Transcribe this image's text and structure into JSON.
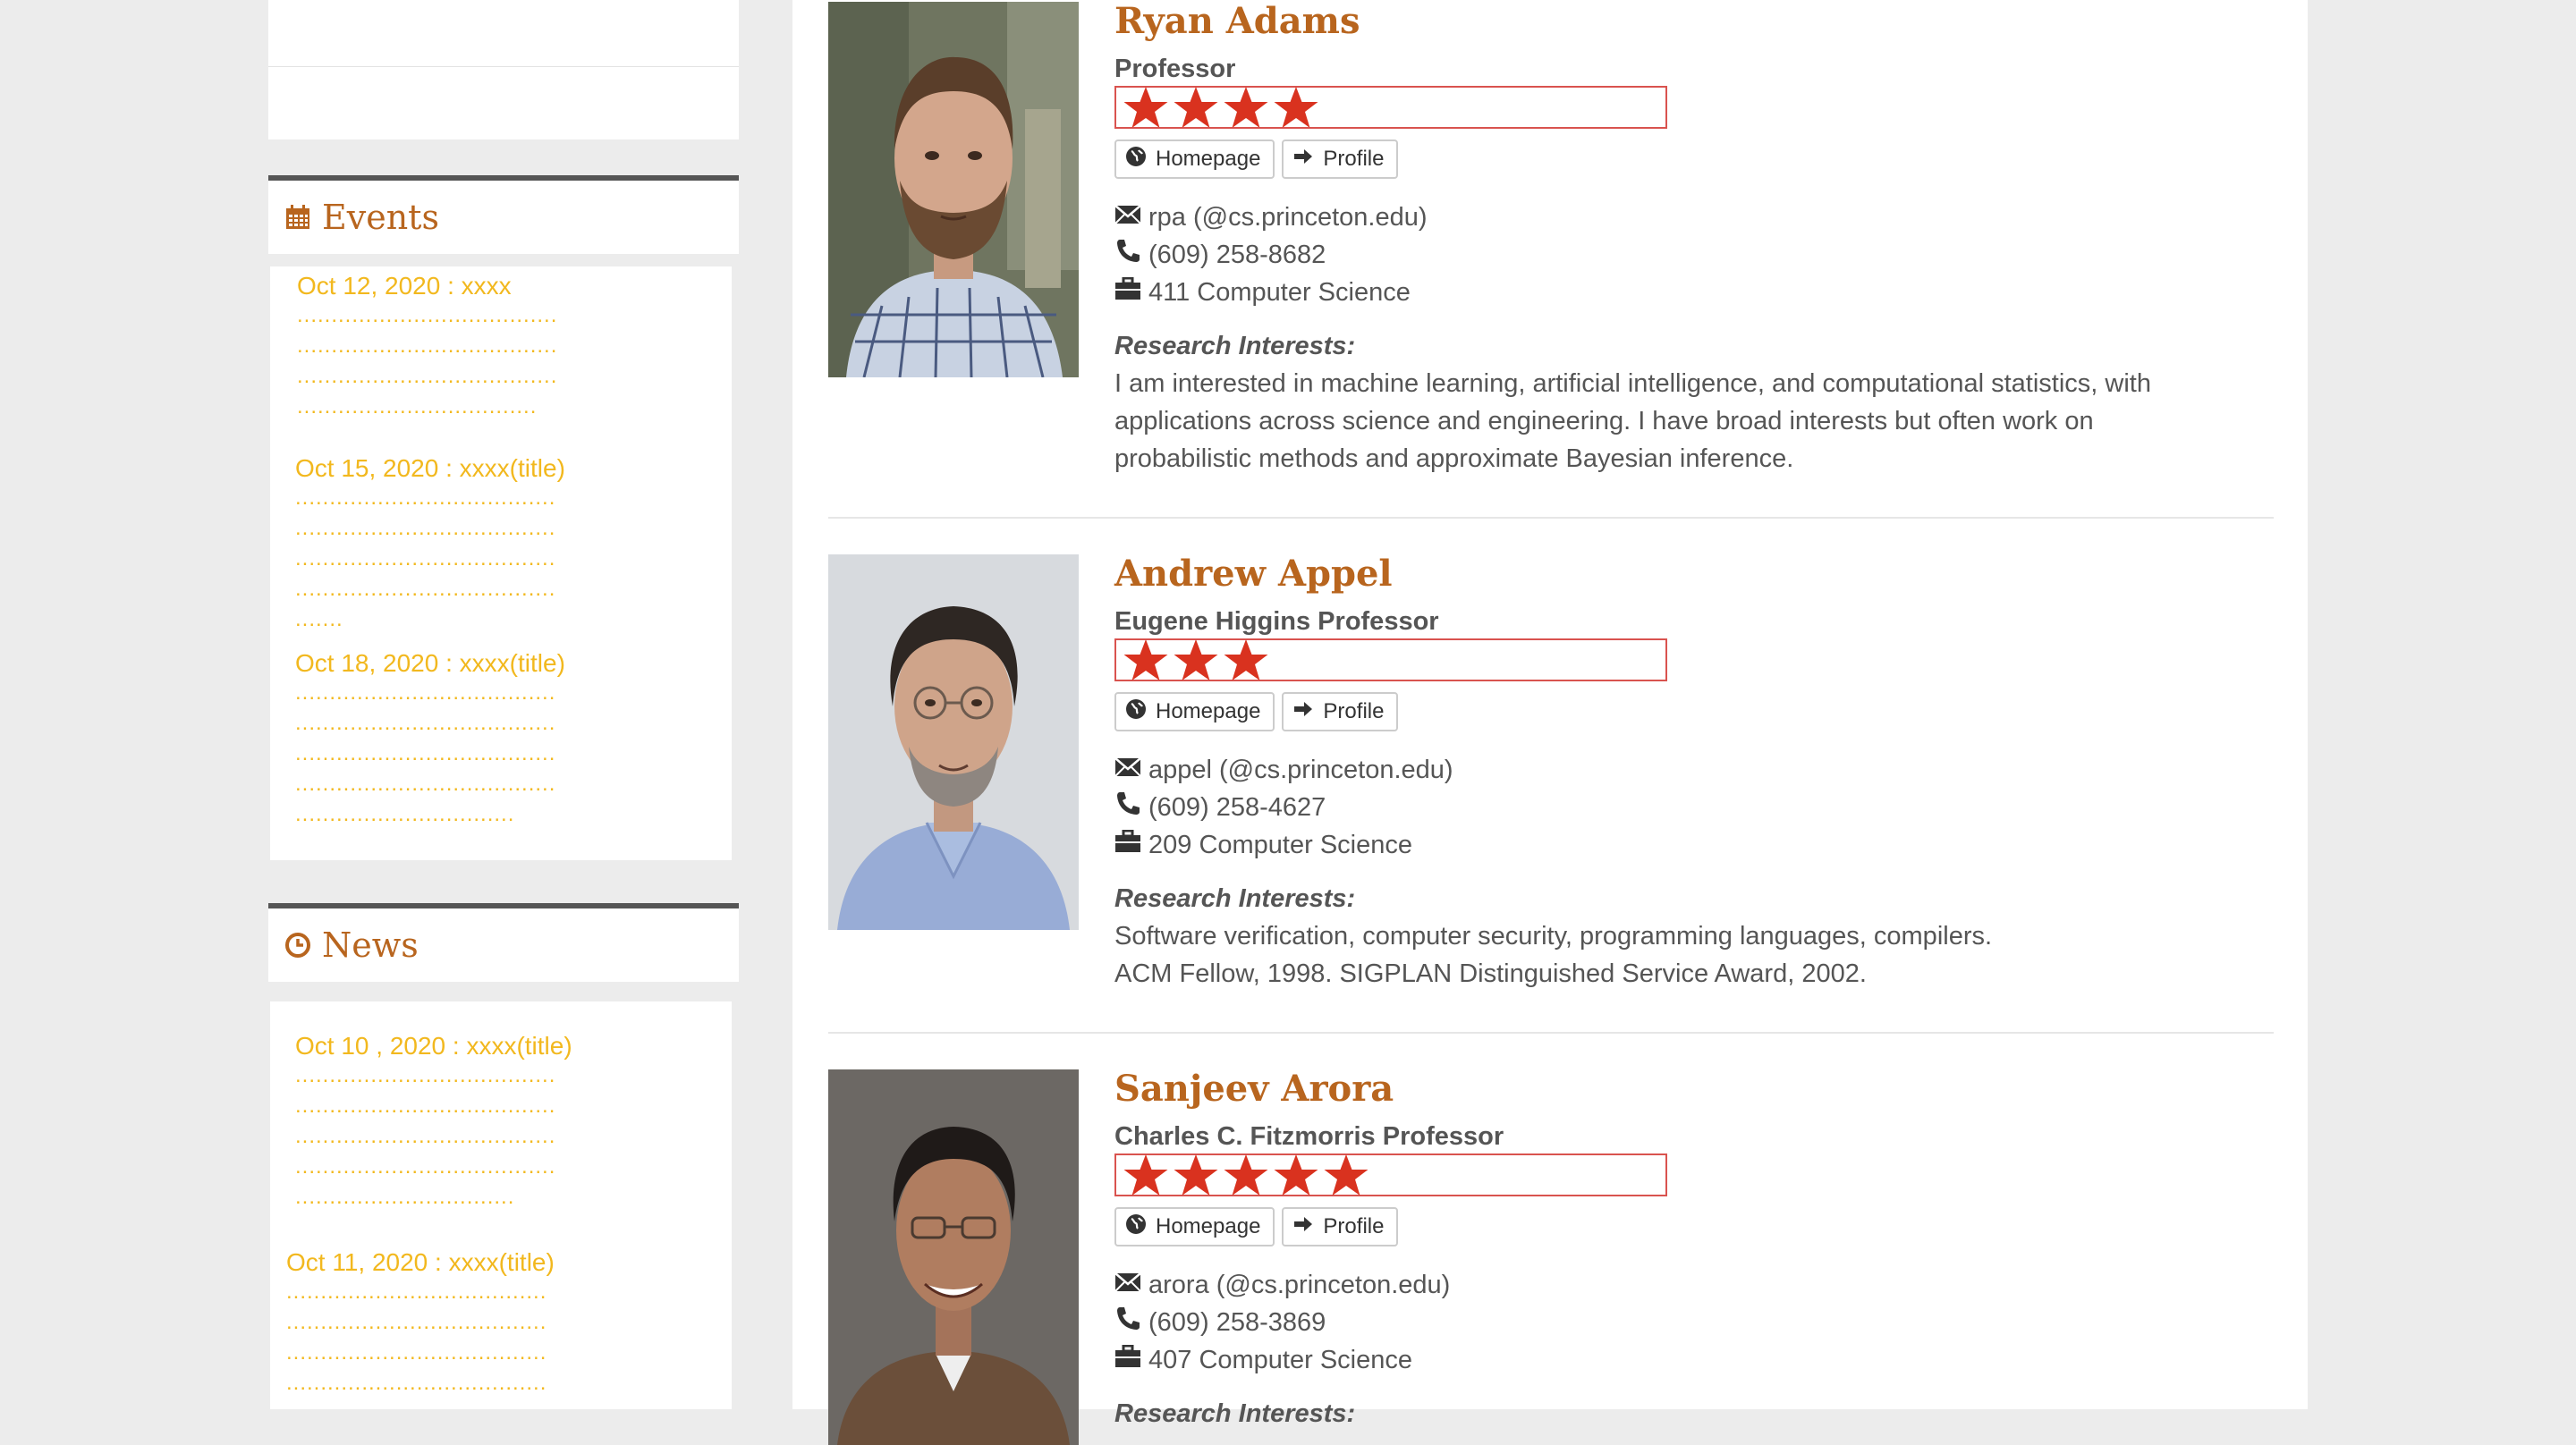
{
  "sidebar": {
    "events": {
      "title": "Events",
      "items": [
        {
          "date": "Oct 12, 2020 :  xxxx",
          "dots": [
            "......................................",
            "......................................",
            "......................................",
            "..................................."
          ]
        },
        {
          "date": "Oct 15, 2020 :  xxxx(title)",
          "dots": [
            "......................................",
            "......................................",
            "......................................",
            "......................................",
            "......."
          ]
        },
        {
          "date": "Oct 18, 2020 :  xxxx(title)",
          "dots": [
            "......................................",
            "......................................",
            "......................................",
            "......................................",
            "................................"
          ]
        }
      ]
    },
    "news": {
      "title": "News",
      "items": [
        {
          "date": "Oct 10 , 2020 :  xxxx(title)",
          "dots": [
            "......................................",
            "......................................",
            "......................................",
            "......................................",
            "................................"
          ]
        },
        {
          "date": "Oct 11, 2020 :  xxxx(title)",
          "dots": [
            "......................................",
            "......................................",
            "......................................",
            "......................................"
          ]
        }
      ]
    }
  },
  "people": [
    {
      "name": "Ryan Adams",
      "rank": "Professor",
      "stars": 4,
      "homepage_label": "Homepage",
      "profile_label": "Profile",
      "email": "rpa  (@cs.princeton.edu)",
      "phone": "(609) 258-8682",
      "office": "411 Computer Science",
      "ri_label": "Research Interests:",
      "ri_lines": [
        "I am interested in machine learning, artificial intelligence, and computational statistics, with",
        "applications across science and engineering. I have broad interests but often work on",
        "probabilistic methods and approximate Bayesian inference."
      ]
    },
    {
      "name": "Andrew Appel",
      "rank": "Eugene Higgins Professor",
      "stars": 3,
      "homepage_label": "Homepage",
      "profile_label": "Profile",
      "email": "appel  (@cs.princeton.edu)",
      "phone": "(609) 258-4627",
      "office": "209 Computer Science",
      "ri_label": "Research Interests:",
      "ri_lines": [
        "Software verification, computer security, programming languages, compilers.",
        "ACM Fellow, 1998. SIGPLAN Distinguished Service Award, 2002."
      ]
    },
    {
      "name": "Sanjeev Arora",
      "rank": "Charles C. Fitzmorris Professor",
      "stars": 5,
      "homepage_label": "Homepage",
      "profile_label": "Profile",
      "email": "arora  (@cs.princeton.edu)",
      "phone": "(609) 258-3869",
      "office": "407 Computer Science",
      "ri_label": "Research Interests:",
      "ri_lines": []
    }
  ],
  "colors": {
    "accent": "#b8651e",
    "link_yellow": "#f2b81e",
    "star_red": "#d9321f"
  }
}
